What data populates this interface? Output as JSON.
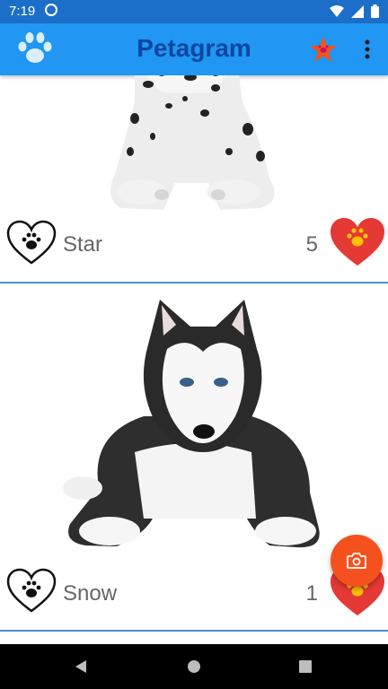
{
  "status_bar": {
    "time": "7:19"
  },
  "app_bar": {
    "title": "Petagram"
  },
  "pets": [
    {
      "name": "Star",
      "likes": "5"
    },
    {
      "name": "Snow",
      "likes": "1"
    }
  ],
  "colors": {
    "status_bar": "#1c6fc9",
    "app_bar": "#2196f3",
    "title": "#0d47a1",
    "star": "#f4511e",
    "fab": "#f4511e",
    "heart": "#e53935",
    "paw_on_heart": "#ffc107",
    "divider": "#4c8fd0"
  },
  "icons": {
    "logo": "paw-icon",
    "favorites": "star-icon",
    "overflow": "more-vert-icon",
    "like": "heart-outline-paw-icon",
    "rating": "heart-paw-icon",
    "fab": "camera-icon"
  }
}
